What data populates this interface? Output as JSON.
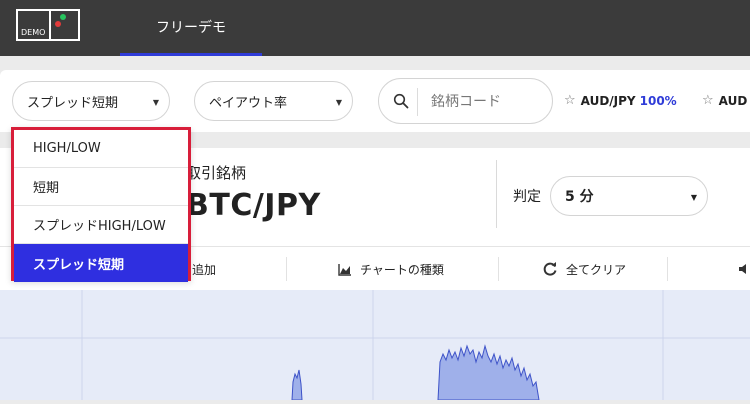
{
  "header": {
    "logo_text": "DEMO",
    "tab_label": "フリーデモ"
  },
  "filters": {
    "type_select": "スプレッド短期",
    "payout_select": "ペイアウト率",
    "search_placeholder": "銘柄コード"
  },
  "favorites": [
    {
      "symbol": "AUD/JPY",
      "payout": "100%"
    },
    {
      "symbol": "AUD"
    }
  ],
  "panel": {
    "label": "取引銘柄",
    "symbol": "BTC/JPY",
    "judge_label": "判定",
    "judge_value": "5 分"
  },
  "toolbar": {
    "add_label": "追加",
    "chart_type_label": "チャートの種類",
    "clear_label": "全てクリア"
  },
  "dropdown": {
    "items": [
      "HIGH/LOW",
      "短期",
      "スプレッドHIGH/LOW",
      "スプレッド短期"
    ],
    "selected_index": 3
  },
  "colors": {
    "accent": "#2f3cd8",
    "highlight_border": "#d81e3a",
    "topbar": "#3b3b3b",
    "chart_fill": "#9fb0ea",
    "chart_line": "#3d52c8"
  },
  "icons": [
    "search-icon",
    "star-icon",
    "chart-type-icon",
    "refresh-icon",
    "speaker-icon"
  ]
}
